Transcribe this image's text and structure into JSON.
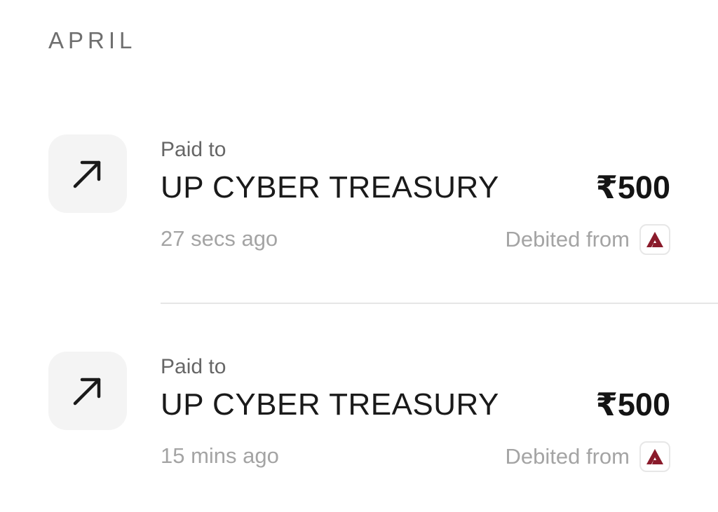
{
  "section": {
    "title": "APRIL"
  },
  "transactions": [
    {
      "direction_icon": "arrow-up-right-icon",
      "label": "Paid to",
      "payee": "UP CYBER TREASURY",
      "amount": "₹500",
      "time": "27 secs ago",
      "debited_label": "Debited from",
      "bank_icon": "bank-logo-icon"
    },
    {
      "direction_icon": "arrow-up-right-icon",
      "label": "Paid to",
      "payee": "UP CYBER TREASURY",
      "amount": "₹500",
      "time": "15 mins ago",
      "debited_label": "Debited from",
      "bank_icon": "bank-logo-icon"
    }
  ],
  "colors": {
    "bank_brand": "#8a1b2b",
    "icon_tile_bg": "#f4f4f4"
  }
}
